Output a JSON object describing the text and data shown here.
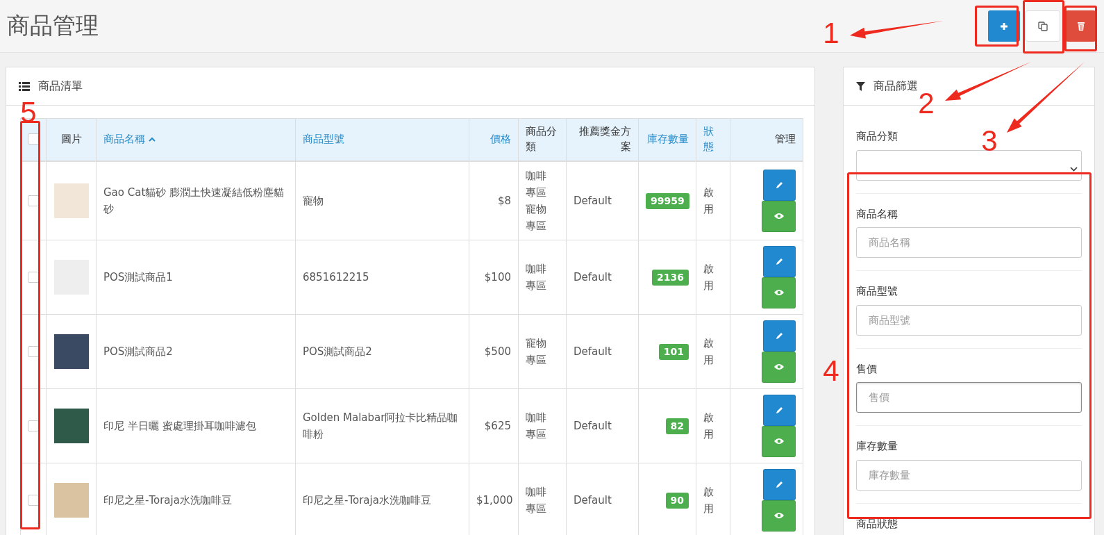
{
  "page": {
    "title": "商品管理"
  },
  "toolbar": [
    {
      "kind": "add"
    },
    {
      "kind": "copy"
    },
    {
      "kind": "delete"
    }
  ],
  "product_list": {
    "title": "商品清單",
    "select_all": {
      "checked": false
    },
    "columns": [
      {
        "label": "圖片",
        "sortable": false,
        "sorted": false
      },
      {
        "label": "商品名稱",
        "sortable": true,
        "sorted": true
      },
      {
        "label": "商品型號",
        "sortable": true,
        "sorted": false
      },
      {
        "label": "價格",
        "sortable": true,
        "sorted": false
      },
      {
        "label": "商品分類",
        "sortable": false,
        "sorted": false
      },
      {
        "label": "推薦獎金方案",
        "sortable": false,
        "sorted": false
      },
      {
        "label": "庫存數量",
        "sortable": true,
        "sorted": false
      },
      {
        "label": "狀態",
        "sortable": true,
        "sorted": false
      },
      {
        "label": "管理",
        "sortable": false,
        "sorted": false
      }
    ],
    "rows": [
      {
        "checked": false,
        "name": "Gao Cat貓砂 膨潤土快速凝結低粉塵貓砂",
        "model": "寵物",
        "price": "$8",
        "categories": [
          "咖啡專區",
          "寵物專區"
        ],
        "bonus_plan": "Default",
        "stock": "99959",
        "status": "啟用"
      },
      {
        "checked": false,
        "name": "POS測試商品1",
        "model": "6851612215",
        "price": "$100",
        "categories": [
          "咖啡專區"
        ],
        "bonus_plan": "Default",
        "stock": "2136",
        "status": "啟用"
      },
      {
        "checked": false,
        "name": "POS測試商品2",
        "model": "POS測試商品2",
        "price": "$500",
        "categories": [
          "寵物專區"
        ],
        "bonus_plan": "Default",
        "stock": "101",
        "status": "啟用"
      },
      {
        "checked": false,
        "name": "印尼 半日曬 蜜處理掛耳咖啡濾包",
        "model": "Golden Malabar阿拉卡比精品咖啡粉",
        "price": "$625",
        "categories": [
          "咖啡專區"
        ],
        "bonus_plan": "Default",
        "stock": "82",
        "status": "啟用"
      },
      {
        "checked": false,
        "name": "印尼之星-Toraja水洗咖啡豆",
        "model": "印尼之星-Toraja水洗咖啡豆",
        "price": "$1,000",
        "categories": [
          "咖啡專區"
        ],
        "bonus_plan": "Default",
        "stock": "90",
        "status": "啟用"
      }
    ]
  },
  "filter": {
    "title": "商品篩選",
    "fields": [
      {
        "kind": "select",
        "label": "商品分類"
      },
      {
        "kind": "text",
        "label": "商品名稱",
        "placeholder": "商品名稱",
        "focused": false
      },
      {
        "kind": "text",
        "label": "商品型號",
        "placeholder": "商品型號",
        "focused": false
      },
      {
        "kind": "text",
        "label": "售價",
        "placeholder": "售價",
        "focused": true
      },
      {
        "kind": "text",
        "label": "庫存數量",
        "placeholder": "庫存數量",
        "focused": false
      },
      {
        "kind": "label",
        "label": "商品狀態"
      }
    ]
  },
  "annotations": [
    {
      "label": "1"
    },
    {
      "label": "2"
    },
    {
      "label": "3"
    },
    {
      "label": "4"
    },
    {
      "label": "5"
    }
  ]
}
